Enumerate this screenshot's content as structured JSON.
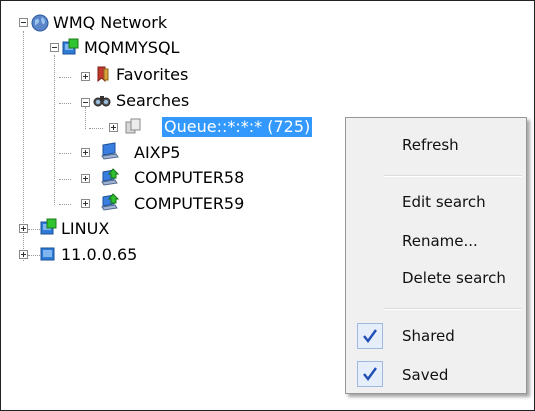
{
  "tree": {
    "root": {
      "label": "WMQ Network"
    },
    "server": {
      "label": "MQMMYSQL"
    },
    "favorites": {
      "label": "Favorites"
    },
    "searches": {
      "label": "Searches"
    },
    "queue_search": {
      "label": "Queue::*:*:* (725)"
    },
    "aixp5": {
      "label": "AIXP5"
    },
    "computer58": {
      "label": "COMPUTER58"
    },
    "computer59": {
      "label": "COMPUTER59"
    },
    "linux": {
      "label": "LINUX"
    },
    "ip": {
      "label": "11.0.0.65"
    }
  },
  "context_menu": {
    "refresh": "Refresh",
    "edit_search": "Edit search",
    "rename": "Rename...",
    "delete_search": "Delete search",
    "shared": {
      "label": "Shared",
      "checked": true
    },
    "saved": {
      "label": "Saved",
      "checked": true
    }
  },
  "colors": {
    "selection": "#3399ff",
    "check": "#1f4fb5"
  }
}
